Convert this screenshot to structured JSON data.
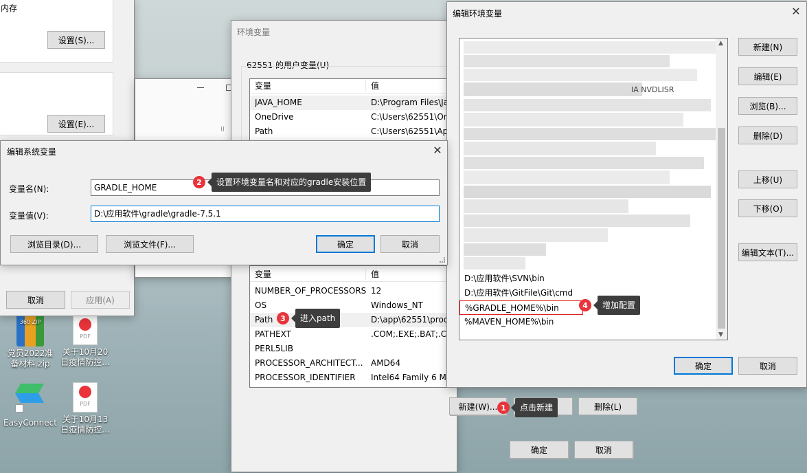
{
  "bg_window": {
    "memory_label": "内存",
    "settings_s": "设置(S)...",
    "settings_e": "设置(E)...",
    "cancel": "取消",
    "apply": "应用(A)"
  },
  "env_window": {
    "title": "环境变量",
    "user_group": "62551 的用户变量(U)",
    "col_name": "变量",
    "col_value": "值",
    "user_vars": [
      {
        "name": "JAVA_HOME",
        "value": "D:\\Program Files\\Ja"
      },
      {
        "name": "OneDrive",
        "value": "C:\\Users\\62551\\On"
      },
      {
        "name": "Path",
        "value": "C:\\Users\\62551\\Ap"
      }
    ],
    "sys_vars": [
      {
        "name": "NUMBER_OF_PROCESSORS",
        "value": "12"
      },
      {
        "name": "OS",
        "value": "Windows_NT"
      },
      {
        "name": "Path",
        "value": "D:\\app\\62551\\proc"
      },
      {
        "name": "PATHEXT",
        "value": ".COM;.EXE;.BAT;.CM"
      },
      {
        "name": "PERL5LIB",
        "value": ""
      },
      {
        "name": "PROCESSOR_ARCHITECT...",
        "value": "AMD64"
      },
      {
        "name": "PROCESSOR_IDENTIFIER",
        "value": "Intel64 Family 6 Mo"
      }
    ],
    "new_btn": "新建(W)...",
    "delete_btn": "删除(L)",
    "ok": "确定",
    "cancel": "取消"
  },
  "edit_sys_var": {
    "title": "编辑系统变量",
    "name_label": "变量名(N):",
    "name_value": "GRADLE_HOME",
    "value_label": "变量值(V):",
    "value_value": "D:\\应用软件\\gradle\\gradle-7.5.1",
    "browse_dir": "浏览目录(D)...",
    "browse_file": "浏览文件(F)...",
    "ok": "确定",
    "cancel": "取消"
  },
  "edit_env_var": {
    "title": "编辑环境变量",
    "blurred_fragment": "IA NVDLISR",
    "entries": [
      "D:\\应用软件\\SVN\\bin",
      "D:\\应用软件\\GitFile\\Git\\cmd",
      "%GRADLE_HOME%\\bin",
      "%MAVEN_HOME%\\bin"
    ],
    "buttons": {
      "new": "新建(N)",
      "edit": "编辑(E)",
      "browse": "浏览(B)...",
      "delete": "删除(D)",
      "up": "上移(U)",
      "down": "下移(O)",
      "edit_text": "编辑文本(T)..."
    },
    "ok": "确定",
    "cancel": "取消"
  },
  "annotations": {
    "b1": "1",
    "t1": "点击新建",
    "b2": "2",
    "t2": "设置环境变量名和对应的gradle安装位置",
    "b3": "3",
    "t3": "进入path",
    "b4": "4",
    "t4": "增加配置"
  },
  "desktop": {
    "icon1": "党员2022准备材料.zip",
    "icon2": "关于10月20日疫情防控...",
    "icon3": "EasyConnect",
    "icon4": "关于10月13日疫情防控...",
    "zip_badge": "360 ZIP",
    "pdf_badge": "PDF"
  },
  "colors": {
    "accent": "#0078d7",
    "badge": "#e8343a",
    "tip": "#3d3d3d",
    "highlight_border": "#e02020"
  }
}
